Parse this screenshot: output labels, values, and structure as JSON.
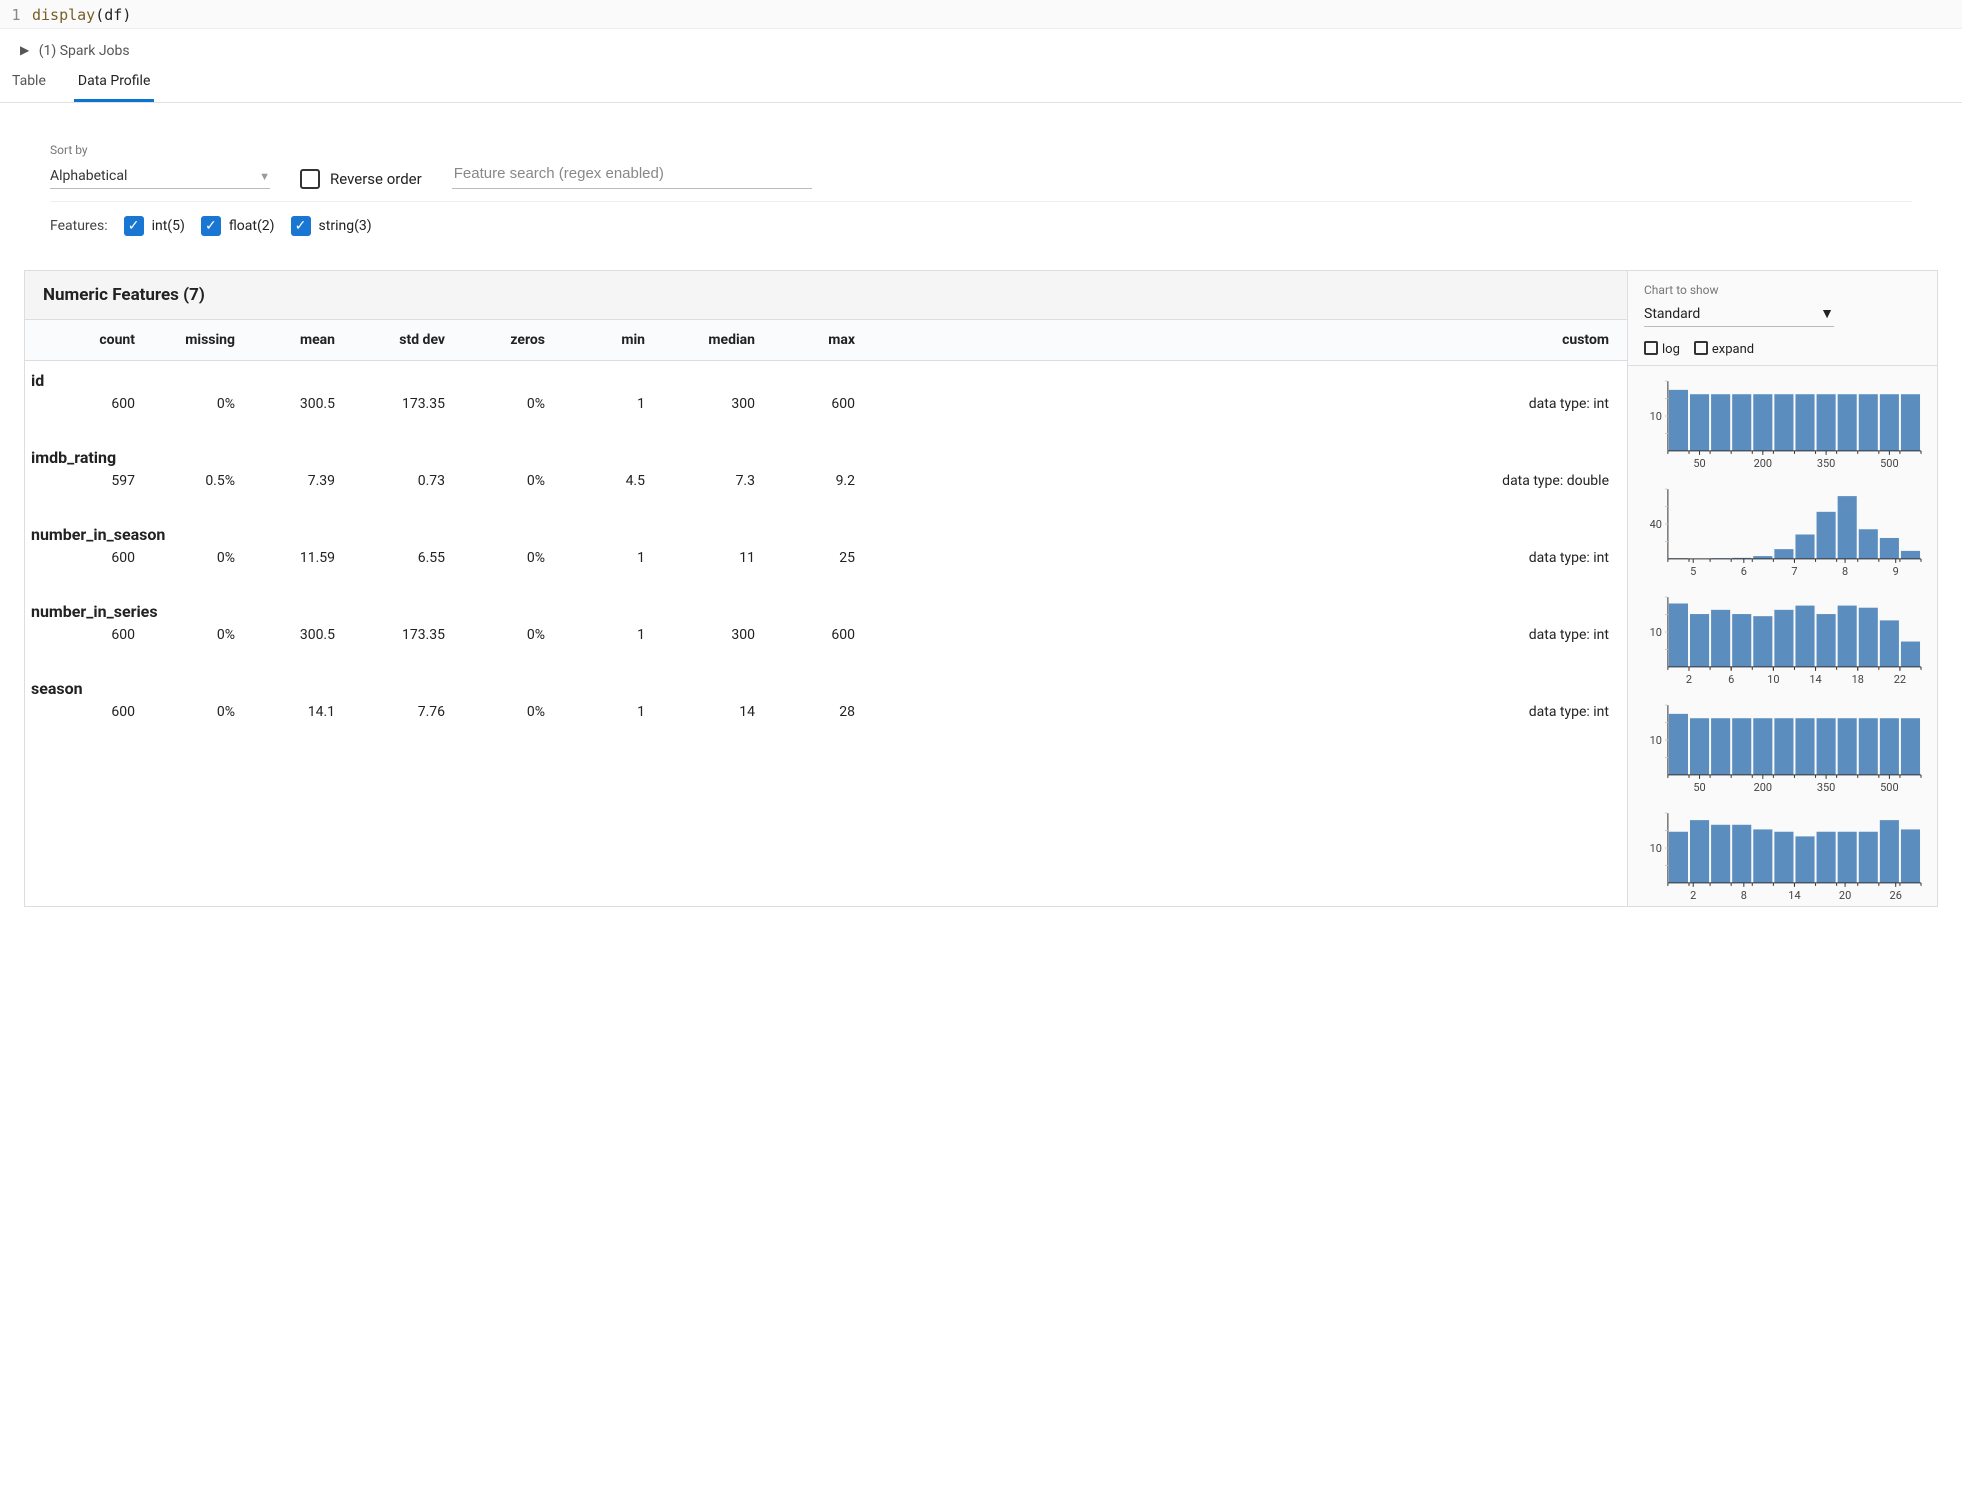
{
  "code": {
    "line_number": "1",
    "call": "display",
    "arg": "df"
  },
  "spark_jobs": "(1) Spark Jobs",
  "tabs": {
    "table": "Table",
    "data_profile": "Data Profile"
  },
  "sort": {
    "label": "Sort by",
    "value": "Alphabetical"
  },
  "reverse_label": "Reverse order",
  "search_placeholder": "Feature search (regex enabled)",
  "features_label": "Features:",
  "feature_chips": {
    "int": "int(5)",
    "float": "float(2)",
    "string": "string(3)"
  },
  "section_title": "Numeric Features (7)",
  "chart_label": "Chart to show",
  "chart_value": "Standard",
  "opts": {
    "log": "log",
    "expand": "expand"
  },
  "columns": {
    "count": "count",
    "missing": "missing",
    "mean": "mean",
    "std": "std dev",
    "zeros": "zeros",
    "min": "min",
    "median": "median",
    "max": "max",
    "custom": "custom"
  },
  "features": [
    {
      "name": "id",
      "count": "600",
      "missing": "0%",
      "mean": "300.5",
      "std": "173.35",
      "zeros": "0%",
      "min": "1",
      "median": "300",
      "max": "600",
      "custom": "data type: int"
    },
    {
      "name": "imdb_rating",
      "count": "597",
      "missing": "0.5%",
      "mean": "7.39",
      "std": "0.73",
      "zeros": "0%",
      "min": "4.5",
      "median": "7.3",
      "max": "9.2",
      "custom": "data type: double"
    },
    {
      "name": "number_in_season",
      "count": "600",
      "missing": "0%",
      "mean": "11.59",
      "std": "6.55",
      "zeros": "0%",
      "min": "1",
      "median": "11",
      "max": "25",
      "custom": "data type: int"
    },
    {
      "name": "number_in_series",
      "count": "600",
      "missing": "0%",
      "mean": "300.5",
      "std": "173.35",
      "zeros": "0%",
      "min": "1",
      "median": "300",
      "max": "600",
      "custom": "data type: int"
    },
    {
      "name": "season",
      "count": "600",
      "missing": "0%",
      "mean": "14.1",
      "std": "7.76",
      "zeros": "0%",
      "min": "1",
      "median": "14",
      "max": "28",
      "custom": "data type: int"
    }
  ],
  "chart_data": [
    {
      "feature": "id",
      "type": "bar",
      "ylabel_tick": "10",
      "x_ticks": [
        "50",
        "200",
        "350",
        "500"
      ],
      "values": [
        14,
        13,
        13,
        13,
        13,
        13,
        13,
        13,
        13,
        13,
        13,
        13
      ],
      "ylim": [
        0,
        16
      ]
    },
    {
      "feature": "imdb_rating",
      "type": "bar",
      "ylabel_tick": "40",
      "x_ticks": [
        "5",
        "6",
        "7",
        "8",
        "9"
      ],
      "values": [
        2,
        1,
        2,
        3,
        8,
        28,
        70,
        135,
        180,
        85,
        60,
        23
      ],
      "ylim": [
        0,
        200
      ]
    },
    {
      "feature": "number_in_season",
      "type": "bar",
      "ylabel_tick": "10",
      "x_ticks": [
        "2",
        "6",
        "10",
        "14",
        "18",
        "22"
      ],
      "values": [
        30,
        25,
        27,
        25,
        24,
        27,
        29,
        25,
        29,
        28,
        22,
        12
      ],
      "ylim": [
        0,
        33
      ]
    },
    {
      "feature": "number_in_series",
      "type": "bar",
      "ylabel_tick": "10",
      "x_ticks": [
        "50",
        "200",
        "350",
        "500"
      ],
      "values": [
        14,
        13,
        13,
        13,
        13,
        13,
        13,
        13,
        13,
        13,
        13,
        13
      ],
      "ylim": [
        0,
        16
      ]
    },
    {
      "feature": "season",
      "type": "bar",
      "ylabel_tick": "10",
      "x_ticks": [
        "2",
        "8",
        "14",
        "20",
        "26"
      ],
      "values": [
        22,
        27,
        25,
        25,
        23,
        22,
        20,
        22,
        22,
        22,
        27,
        23
      ],
      "ylim": [
        0,
        30
      ]
    }
  ]
}
